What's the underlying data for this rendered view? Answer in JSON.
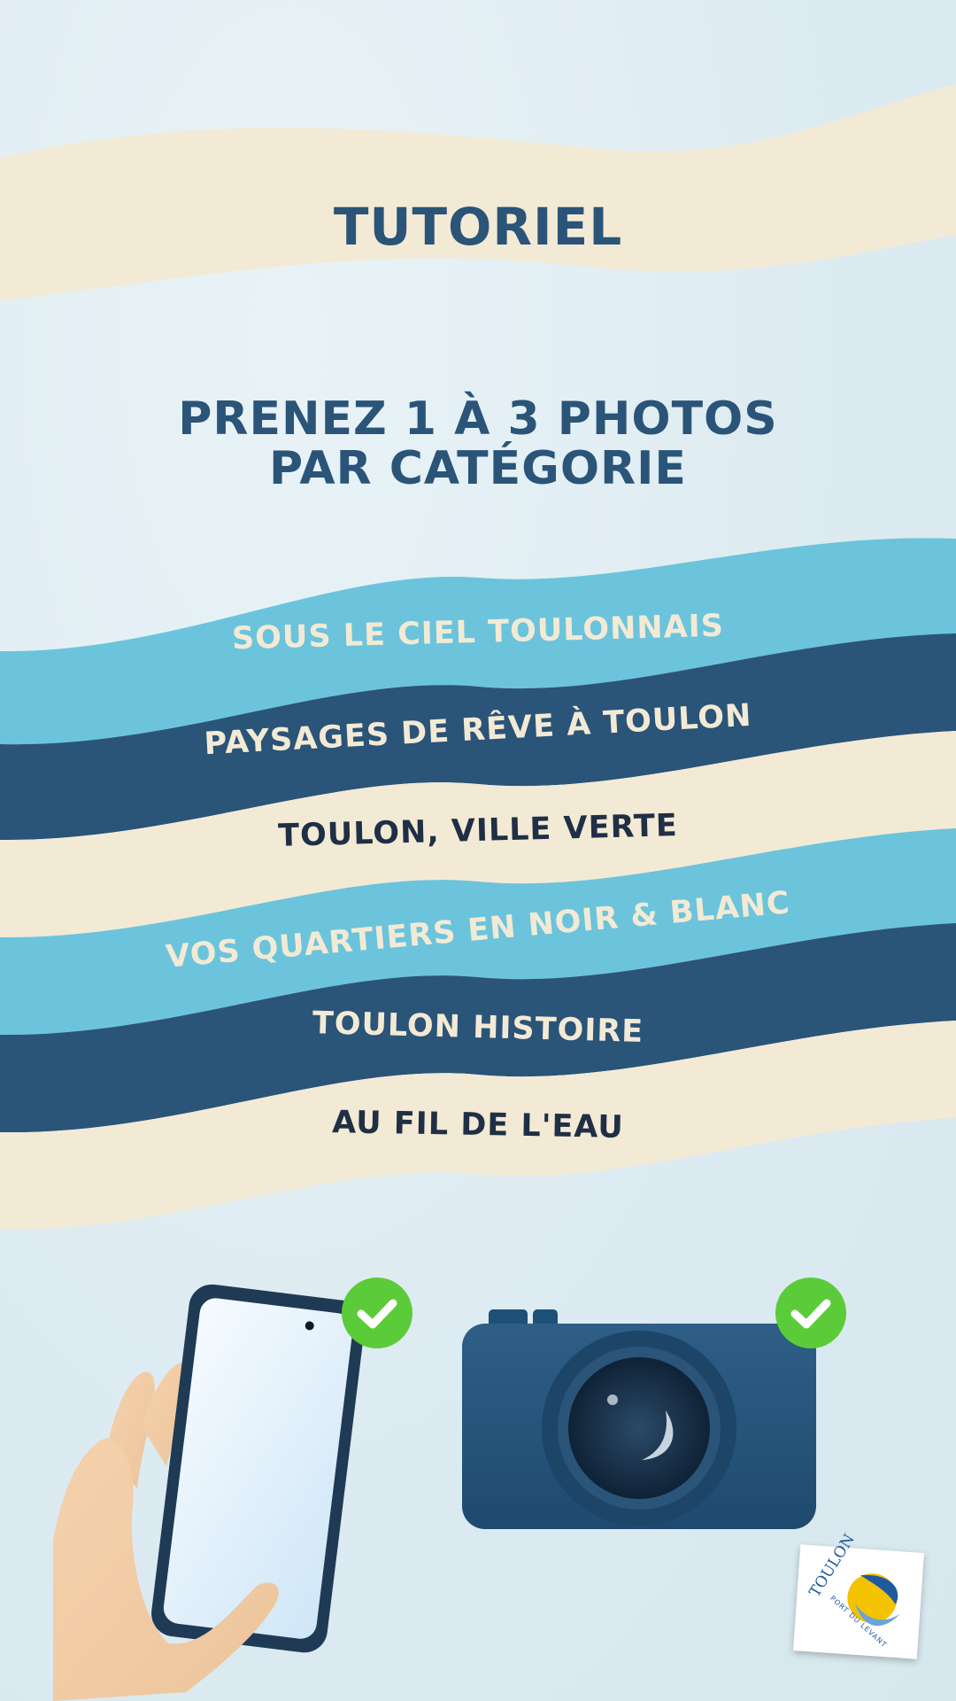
{
  "tutorial_title": "Tutoriel",
  "instruction": {
    "line1": "Prenez 1 à 3 photos",
    "line2": "par catégorie"
  },
  "categories": [
    {
      "label": "Sous le ciel toulonnais",
      "band_color": "#6bc4dc",
      "text_color": "#f3ead5"
    },
    {
      "label": "Paysages de rêve à Toulon",
      "band_color": "#2a5478",
      "text_color": "#f3ead5"
    },
    {
      "label": "Toulon, ville verte",
      "band_color": "#f3ead5",
      "text_color": "#1f2f45"
    },
    {
      "label": "Vos quartiers en noir & blanc",
      "band_color": "#6bc4dc",
      "text_color": "#f3ead5"
    },
    {
      "label": "Toulon Histoire",
      "band_color": "#2a5478",
      "text_color": "#f3ead5"
    },
    {
      "label": "Au fil de l'eau",
      "band_color": "#f3ead5",
      "text_color": "#1f2f45"
    }
  ],
  "devices": [
    {
      "name": "smartphone",
      "icon": "phone-icon",
      "status": "allowed"
    },
    {
      "name": "camera",
      "icon": "camera-icon",
      "status": "allowed"
    }
  ],
  "logo": {
    "word": "TOULON",
    "tagline": "PORT DU LEVANT"
  },
  "colors": {
    "background": "#e2eef3",
    "cream": "#f3ead5",
    "navy": "#2a5478",
    "sky": "#6bc4dc",
    "check_green": "#5ccb3a"
  }
}
